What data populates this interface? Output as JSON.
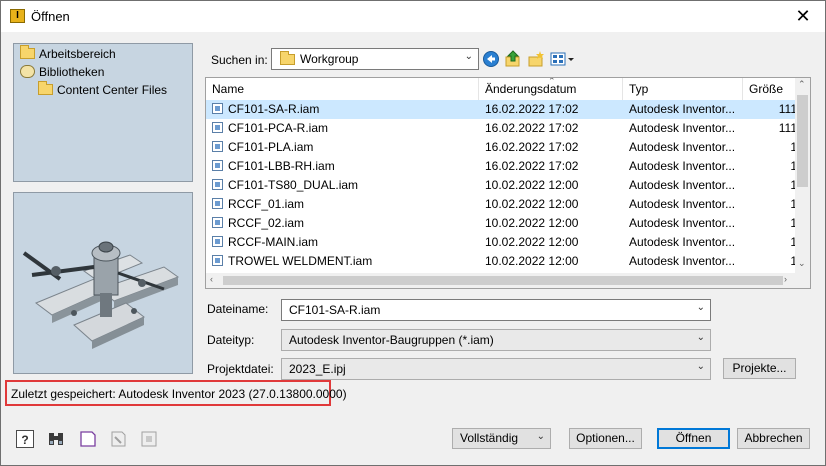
{
  "window": {
    "title": "Öffnen"
  },
  "sidebar": {
    "items": [
      {
        "label": "Arbeitsbereich",
        "icon": "folder-icon"
      },
      {
        "label": "Bibliotheken",
        "icon": "library-icon"
      },
      {
        "label": "Content Center Files",
        "icon": "folder-icon"
      }
    ]
  },
  "lookin": {
    "label": "Suchen in:",
    "value": "Workgroup"
  },
  "filelist": {
    "columns": [
      "Name",
      "Änderungsdatum",
      "Typ",
      "Größe"
    ],
    "rows": [
      {
        "name": "CF101-SA-R.iam",
        "date": "16.02.2022 17:02",
        "type": "Autodesk Inventor...",
        "size": "111",
        "selected": true
      },
      {
        "name": "CF101-PCA-R.iam",
        "date": "16.02.2022 17:02",
        "type": "Autodesk Inventor...",
        "size": "111"
      },
      {
        "name": "CF101-PLA.iam",
        "date": "16.02.2022 17:02",
        "type": "Autodesk Inventor...",
        "size": "1"
      },
      {
        "name": "CF101-LBB-RH.iam",
        "date": "16.02.2022 17:02",
        "type": "Autodesk Inventor...",
        "size": "1"
      },
      {
        "name": "CF101-TS80_DUAL.iam",
        "date": "10.02.2022 12:00",
        "type": "Autodesk Inventor...",
        "size": "1"
      },
      {
        "name": "RCCF_01.iam",
        "date": "10.02.2022 12:00",
        "type": "Autodesk Inventor...",
        "size": "1"
      },
      {
        "name": "RCCF_02.iam",
        "date": "10.02.2022 12:00",
        "type": "Autodesk Inventor...",
        "size": "1"
      },
      {
        "name": "RCCF-MAIN.iam",
        "date": "10.02.2022 12:00",
        "type": "Autodesk Inventor...",
        "size": "1"
      },
      {
        "name": "TROWEL WELDMENT.iam",
        "date": "10.02.2022 12:00",
        "type": "Autodesk Inventor...",
        "size": "1"
      }
    ]
  },
  "fields": {
    "filename_label": "Dateiname:",
    "filename_value": "CF101-SA-R.iam",
    "filetype_label": "Dateityp:",
    "filetype_value": "Autodesk Inventor-Baugruppen (*.iam)",
    "project_label": "Projektdatei:",
    "project_value": "2023_E.ipj",
    "projects_button": "Projekte..."
  },
  "status": {
    "text": "Zuletzt gespeichert: Autodesk Inventor 2023 (27.0.13800.0000)"
  },
  "footer": {
    "mode_value": "Vollständig",
    "options_button": "Optionen...",
    "open_button": "Öffnen",
    "cancel_button": "Abbrechen"
  },
  "colors": {
    "selection": "#cce8ff",
    "sidebar": "#c7d5e1",
    "highlight_border": "#e0393a",
    "accent": "#0078d7"
  }
}
